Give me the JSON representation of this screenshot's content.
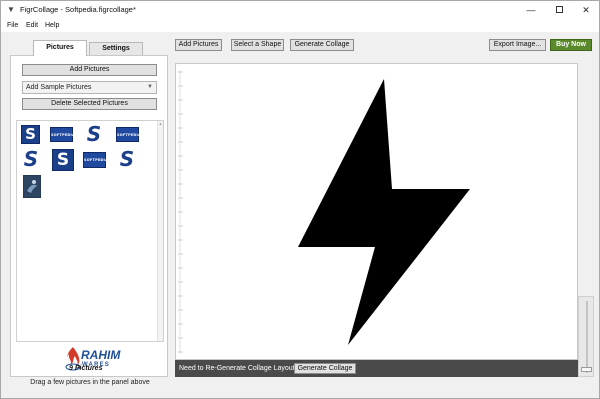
{
  "window": {
    "title": "FigrCollage - Softpedia.figrcollage*",
    "icon": "app-icon",
    "min_glyph": "—",
    "close_glyph": "✕"
  },
  "menu": {
    "items": [
      "File",
      "Edit",
      "Help"
    ]
  },
  "left_panel": {
    "tabs": [
      "Pictures",
      "Settings"
    ],
    "active_tab": "Pictures",
    "add_pictures": "Add Pictures",
    "sample_combo": "Add Sample Pictures",
    "delete_selected": "Delete Selected Pictures",
    "thumbnails": [
      {
        "kind": "big",
        "glyph": "S"
      },
      {
        "kind": "wide",
        "glyph": "SOFTPEDIA"
      },
      {
        "kind": "s-only",
        "glyph": "S"
      },
      {
        "kind": "wide",
        "glyph": "SOFTPEDIA"
      },
      {
        "kind": "s-only",
        "glyph": "S"
      },
      {
        "kind": "big",
        "glyph": "S"
      },
      {
        "kind": "wide",
        "glyph": "SOFTPEDIA"
      },
      {
        "kind": "s-only",
        "glyph": "S"
      },
      {
        "kind": "photo",
        "glyph": ""
      }
    ],
    "watermark_line1": "RAHIM",
    "watermark_line2": "WARES",
    "picture_count": "9 Pictures",
    "drag_hint": "Drag a few pictures in the panel above"
  },
  "toolbar": {
    "add_pictures": "Add Pictures",
    "select_shape": "Select a Shape",
    "generate_collage": "Generate Collage",
    "export_image": "Export Image...",
    "buy_now": "Buy Now",
    "buy_color": "#5a8a2c"
  },
  "canvas": {
    "shape": "lightning-bolt",
    "shape_color": "#000000"
  },
  "status": {
    "message": "Need to Re-Generate Collage Layout",
    "generate_collage": "Generate Collage"
  }
}
